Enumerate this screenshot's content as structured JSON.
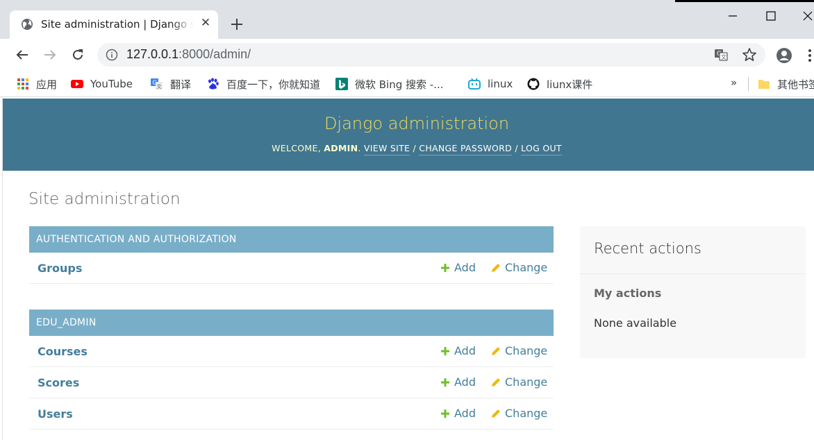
{
  "browser": {
    "tab_title": "Site administration | Django site admin",
    "url_host": "127.0.0.1",
    "url_rest": ":8000/admin/",
    "bookmarks": [
      {
        "label": "应用",
        "icon": "apps-grid-icon"
      },
      {
        "label": "YouTube",
        "icon": "youtube-icon"
      },
      {
        "label": "翻译",
        "icon": "translate-icon"
      },
      {
        "label": "百度一下，你就知道",
        "icon": "baidu-icon"
      },
      {
        "label": "微软 Bing 搜索 -...",
        "icon": "bing-icon"
      },
      {
        "label": "linux",
        "icon": "bilibili-icon"
      },
      {
        "label": "liunx课件",
        "icon": "github-icon"
      },
      {
        "label": "其他书签",
        "icon": "folder-icon"
      }
    ],
    "more": "»"
  },
  "admin": {
    "brand": "Django administration",
    "welcome": "Welcome, ",
    "username": "admin",
    "view_site": "View site",
    "change_password": "Change password",
    "log_out": "Log out",
    "sep": " / ",
    "page_title": "Site administration",
    "modules": [
      {
        "caption": "Authentication and Authorization",
        "rows": [
          {
            "name": "Groups",
            "add": "Add",
            "change": "Change"
          }
        ]
      },
      {
        "caption": "EDU_ADMIN",
        "rows": [
          {
            "name": "Courses",
            "add": "Add",
            "change": "Change"
          },
          {
            "name": "Scores",
            "add": "Add",
            "change": "Change"
          },
          {
            "name": "Users",
            "add": "Add",
            "change": "Change"
          }
        ]
      }
    ],
    "recent_title": "Recent actions",
    "my_actions": "My actions",
    "none_available": "None available"
  },
  "colors": {
    "header": "#417690",
    "brand": "#f5dd5d",
    "caption": "#79aec8",
    "link": "#447e9b",
    "add_icon": "#70bf2b",
    "change_icon": "#efb80b"
  }
}
